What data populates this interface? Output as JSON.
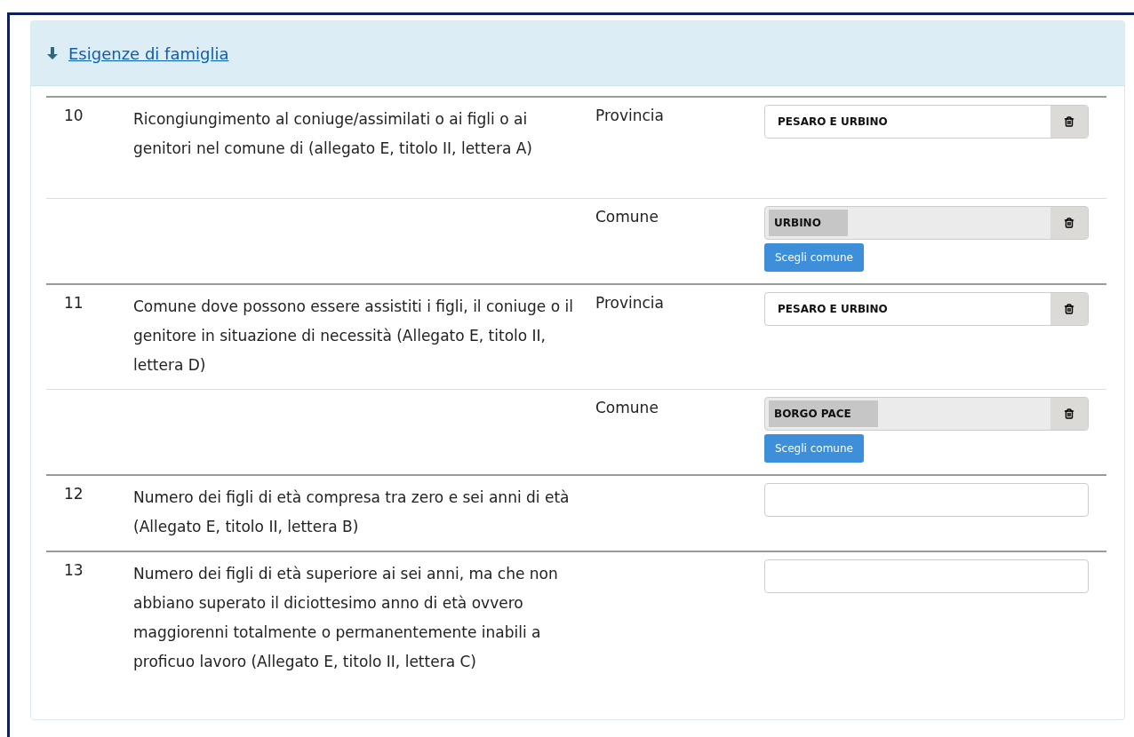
{
  "section": {
    "title": "Esigenze di famiglia",
    "expanded": true
  },
  "items": [
    {
      "number": "10",
      "description": "Ricongiungimento al coniuge/assimilati o ai figli o ai genitori nel comune di (allegato E, titolo II, lettera A)",
      "fields": [
        {
          "kind": "province",
          "label": "Provincia",
          "value": "PESARO E URBINO"
        },
        {
          "kind": "comune",
          "label": "Comune",
          "value": "URBINO",
          "button": "Scegli comune"
        }
      ]
    },
    {
      "number": "11",
      "description": "Comune dove possono essere assistiti i figli, il coniuge o il genitore in situazione di necessità (Allegato E, titolo II, lettera D)",
      "fields": [
        {
          "kind": "province",
          "label": "Provincia",
          "value": "PESARO E URBINO"
        },
        {
          "kind": "comune",
          "label": "Comune",
          "value": "BORGO PACE",
          "button": "Scegli comune"
        }
      ]
    },
    {
      "number": "12",
      "description": "Numero dei figli di età compresa tra zero e sei anni di età (Allegato E, titolo II, lettera B)",
      "fields": [
        {
          "kind": "text"
        }
      ]
    },
    {
      "number": "13",
      "description": "Numero dei figli di età superiore ai sei anni, ma che non abbiano superato il diciottesimo anno di età ovvero maggiorenni totalmente o permanentemente inabili a proficuo lavoro (Allegato E, titolo II, lettera C)",
      "fields": [
        {
          "kind": "text"
        }
      ]
    }
  ]
}
